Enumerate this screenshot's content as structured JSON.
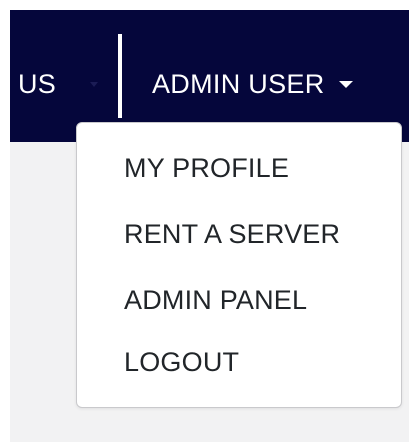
{
  "navbar": {
    "left_item_label": "US",
    "user_menu_label": "ADMIN USER",
    "background_color": "#05063b",
    "text_color": "#ffffff"
  },
  "user_dropdown": {
    "items": [
      {
        "label": "MY PROFILE"
      },
      {
        "label": "RENT A SERVER"
      },
      {
        "label": "ADMIN PANEL"
      },
      {
        "label": "LOGOUT"
      }
    ]
  },
  "icons": {
    "user_menu_caret": "caret-down-icon",
    "left_item_caret": "caret-down-icon"
  }
}
